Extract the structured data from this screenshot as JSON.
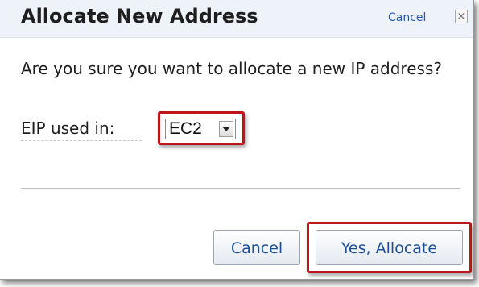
{
  "dialog": {
    "title": "Allocate New Address",
    "header_cancel_label": "Cancel",
    "close_glyph": "×",
    "question": "Are you sure you want to allocate a new IP address?",
    "eip_label": "EIP used in:",
    "eip_select": {
      "selected_value": "EC2"
    },
    "buttons": {
      "cancel_label": "Cancel",
      "confirm_label": "Yes, Allocate"
    }
  },
  "colors": {
    "title_bar_bg": "#eef3f9",
    "link": "#1f5cb0",
    "button_text": "#1a4f97",
    "highlight_border": "#c0141c"
  },
  "icons": {
    "close": "close-icon",
    "dropdown": "chevron-down-icon"
  }
}
